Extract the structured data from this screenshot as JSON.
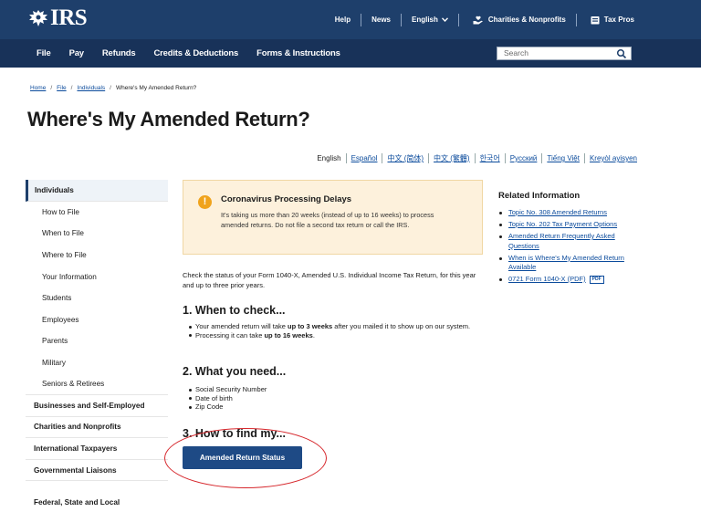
{
  "header": {
    "logo_text": "IRS",
    "links": {
      "help": "Help",
      "news": "News",
      "language": "English",
      "charities": "Charities & Nonprofits",
      "tax_pros": "Tax Pros"
    }
  },
  "nav": {
    "items": [
      "File",
      "Pay",
      "Refunds",
      "Credits & Deductions",
      "Forms & Instructions"
    ],
    "search_placeholder": "Search"
  },
  "breadcrumb": {
    "home": "Home",
    "file": "File",
    "individuals": "Individuals",
    "current": "Where's My Amended Return?"
  },
  "page_title": "Where's My Amended Return?",
  "languages": [
    "English",
    "Español",
    "中文 (简体)",
    "中文 (繁體)",
    "한국어",
    "Русский",
    "Tiếng Việt",
    "Kreyòl ayisyen"
  ],
  "sidebar": {
    "active": "Individuals",
    "sub_items": [
      "How to File",
      "When to File",
      "Where to File",
      "Your Information",
      "Students",
      "Employees",
      "Parents",
      "Military",
      "Seniors & Retirees"
    ],
    "top_items": [
      "Businesses and Self-Employed",
      "Charities and Nonprofits",
      "International Taxpayers",
      "Governmental Liaisons"
    ],
    "cut_item": "Federal, State and Local"
  },
  "alert": {
    "title": "Coronavirus Processing Delays",
    "body": "It's taking us more than 20 weeks (instead of up to 16 weeks) to process amended returns. Do not file a second tax return or call the IRS."
  },
  "intro": "Check the status of your Form 1040-X, Amended U.S. Individual Income Tax Return, for this year and up to three prior years.",
  "sections": {
    "when": {
      "heading": "1. When to check...",
      "item1_pre": "Your amended return will take ",
      "item1_bold": "up to 3 weeks",
      "item1_post": " after you mailed it to show up on our system.",
      "item2_pre": "Processing it can take ",
      "item2_bold": "up to 16 weeks",
      "item2_post": "."
    },
    "what": {
      "heading": "2. What you need...",
      "items": [
        "Social Security Number",
        "Date of birth",
        "Zip Code"
      ]
    },
    "how": {
      "heading": "3. How to find my...",
      "button": "Amended Return Status"
    }
  },
  "related": {
    "title": "Related Information",
    "links": [
      "Topic No. 308 Amended Returns",
      "Topic No. 202 Tax Payment Options",
      "Amended Return Frequently Asked Questions",
      "When is Where's My Amended Return Available",
      "0721 Form 1040-X (PDF)"
    ],
    "pdf_badge": "PDF"
  },
  "colors": {
    "header_bg": "#1e3f6b",
    "nav_bg": "#183259",
    "link": "#0b4b9c",
    "alert_bg": "#fdf1dc",
    "alert_icon": "#f0a31c",
    "button_bg": "#1e4a85",
    "annotation_ring": "#d6262b"
  }
}
